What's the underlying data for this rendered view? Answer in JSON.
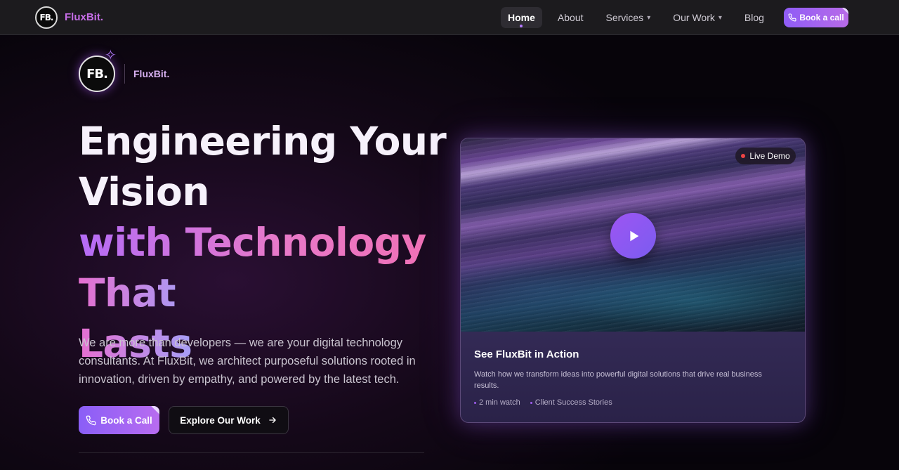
{
  "nav": {
    "logo_text": "FB.",
    "brand": "FluxBit.",
    "links": [
      {
        "label": "Home",
        "active": true
      },
      {
        "label": "About"
      },
      {
        "label": "Services",
        "dropdown": true
      },
      {
        "label": "Our Work",
        "dropdown": true
      },
      {
        "label": "Blog"
      }
    ],
    "cta_label": "Book a call"
  },
  "hero": {
    "logo_text": "FB.",
    "brand": "FluxBit.",
    "headline_line1": "Engineering Your",
    "headline_line2": "Vision",
    "headline_line3": "with Technology",
    "headline_line4": "That Lasts",
    "lead": "We are more than developers — we are your digital technology consultants. At FluxBit, we architect purposeful solutions rooted in innovation, driven by empathy, and powered by the latest tech.",
    "primary_button": "Book a Call",
    "secondary_button": "Explore Our Work"
  },
  "video_card": {
    "badge": "Live Demo",
    "title": "See FluxBit in Action",
    "description": "Watch how we transform ideas into powerful digital solutions that drive real business results.",
    "meta": [
      "2 min watch",
      "Client Success Stories"
    ]
  },
  "colors": {
    "accent": "#8f5cf6",
    "brand_pink": "#c56de6",
    "live_red": "#ef4444"
  },
  "icons": [
    "phone-icon",
    "chevron-down-icon",
    "arrow-right-icon",
    "play-icon",
    "sparkle-icon"
  ]
}
